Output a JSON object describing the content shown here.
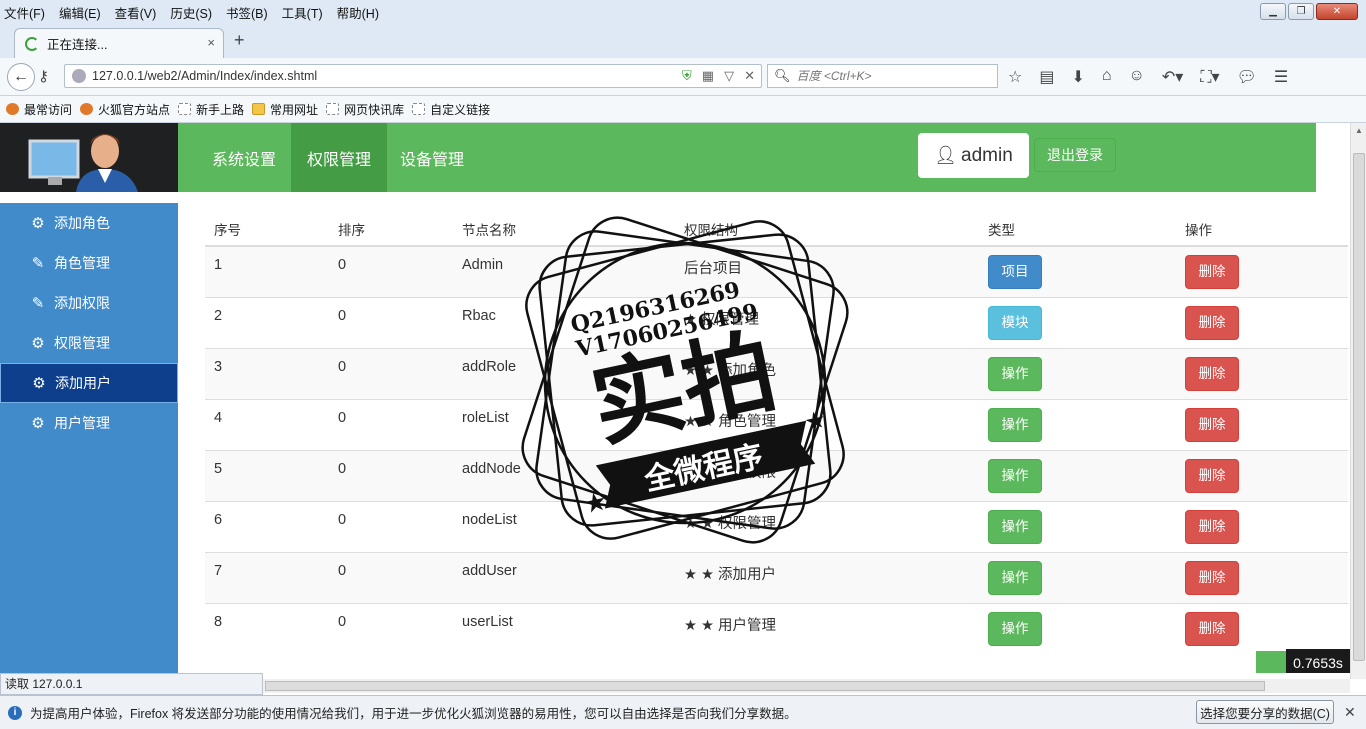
{
  "menu": [
    "文件(F)",
    "编辑(E)",
    "查看(V)",
    "历史(S)",
    "书签(B)",
    "工具(T)",
    "帮助(H)"
  ],
  "tab": {
    "title": "正在连接...",
    "close": "×",
    "new": "+"
  },
  "url": "127.0.0.1/web2/Admin/Index/index.shtml",
  "search_placeholder": "百度 <Ctrl+K>",
  "bookmarks": [
    "最常访问",
    "火狐官方站点",
    "新手上路",
    "常用网址",
    "网页快讯库",
    "自定义链接"
  ],
  "topnav": {
    "items": [
      "系统设置",
      "权限管理",
      "设备管理"
    ],
    "active": 1
  },
  "user": {
    "name": "admin",
    "logout": "退出登录"
  },
  "sidebar": {
    "items": [
      {
        "label": "添加角色",
        "icon": "gear-icon"
      },
      {
        "label": "角色管理",
        "icon": "pencil-icon"
      },
      {
        "label": "添加权限",
        "icon": "pencil-icon"
      },
      {
        "label": "权限管理",
        "icon": "gear-icon"
      },
      {
        "label": "添加用户",
        "icon": "gear-icon",
        "active": true
      },
      {
        "label": "用户管理",
        "icon": "gear-icon"
      }
    ]
  },
  "table": {
    "headers": [
      "序号",
      "排序",
      "节点名称",
      "权限结构",
      "类型",
      "操作"
    ],
    "rows": [
      {
        "id": "1",
        "sort": "0",
        "name": "Admin",
        "structure": "后台项目",
        "type": "项目",
        "type_style": "primary",
        "action": "删除"
      },
      {
        "id": "2",
        "sort": "0",
        "name": "Rbac",
        "structure": "★ 权限管理",
        "type": "模块",
        "type_style": "info",
        "action": "删除"
      },
      {
        "id": "3",
        "sort": "0",
        "name": "addRole",
        "structure": "★ ★ 添加角色",
        "type": "操作",
        "type_style": "success",
        "action": "删除"
      },
      {
        "id": "4",
        "sort": "0",
        "name": "roleList",
        "structure": "★ ★ 角色管理",
        "type": "操作",
        "type_style": "success",
        "action": "删除"
      },
      {
        "id": "5",
        "sort": "0",
        "name": "addNode",
        "structure": "★ ★ 添加权限",
        "type": "操作",
        "type_style": "success",
        "action": "删除"
      },
      {
        "id": "6",
        "sort": "0",
        "name": "nodeList",
        "structure": "★ ★ 权限管理",
        "type": "操作",
        "type_style": "success",
        "action": "删除"
      },
      {
        "id": "7",
        "sort": "0",
        "name": "addUser",
        "structure": "★ ★ 添加用户",
        "type": "操作",
        "type_style": "success",
        "action": "删除"
      },
      {
        "id": "8",
        "sort": "0",
        "name": "userList",
        "structure": "★ ★ 用户管理",
        "type": "操作",
        "type_style": "success",
        "action": "删除"
      }
    ]
  },
  "watermark": {
    "line1": "Q2196316269",
    "line2": "V17060256499",
    "main": "实拍",
    "banner": "全微程序"
  },
  "timer": "0.7653s",
  "status": "读取 127.0.0.1",
  "notification": {
    "message": "为提高用户体验，Firefox 将发送部分功能的使用情况给我们，用于进一步优化火狐浏览器的易用性，您可以自由选择是否向我们分享数据。",
    "button": "选择您要分享的数据(C)"
  }
}
